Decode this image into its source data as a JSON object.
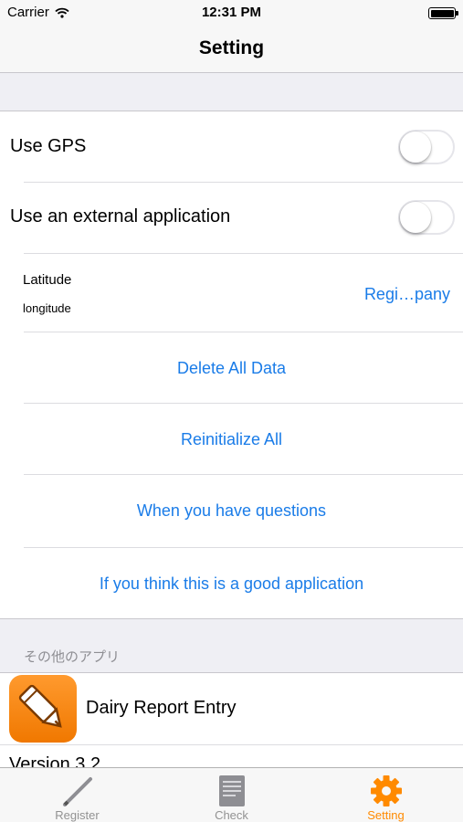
{
  "status_bar": {
    "carrier": "Carrier",
    "time": "12:31 PM"
  },
  "nav": {
    "title": "Setting"
  },
  "settings": {
    "use_gps": {
      "label": "Use GPS",
      "enabled": false
    },
    "use_external_app": {
      "label": "Use an external application",
      "enabled": false
    },
    "location": {
      "latitude_label": "Latitude",
      "longitude_label": "longitude",
      "register_label": "Regi…pany"
    },
    "delete_all": "Delete All Data",
    "reinitialize": "Reinitialize All",
    "questions": "When you have questions",
    "good_app": "If you think this is a good application"
  },
  "other_apps": {
    "header": "その他のアプリ",
    "app_name": "Dairy Report Entry",
    "version": "Version 3.2"
  },
  "tab_bar": {
    "tabs": [
      {
        "label": "Register",
        "icon": "pen-icon",
        "active": false
      },
      {
        "label": "Check",
        "icon": "document-icon",
        "active": false
      },
      {
        "label": "Setting",
        "icon": "gear-icon",
        "active": true
      }
    ]
  },
  "colors": {
    "link": "#1a7ce8",
    "accent": "#ff8a00",
    "background": "#efeff4"
  }
}
